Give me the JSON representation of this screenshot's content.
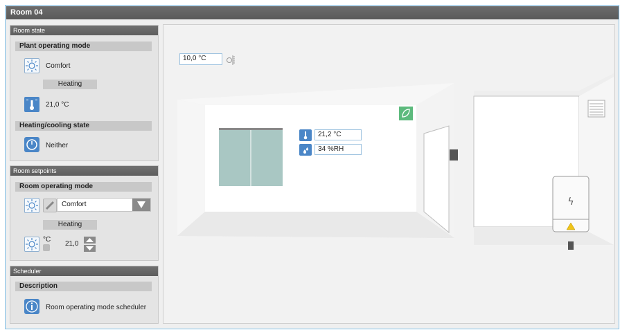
{
  "window": {
    "title": "Room 04"
  },
  "room_state": {
    "header": "Room state",
    "plant_mode": {
      "title": "Plant operating mode",
      "value": "Comfort",
      "status": "Heating",
      "temperature": "21,0 °C"
    },
    "hc_state": {
      "title": "Heating/cooling state",
      "value": "Neither"
    }
  },
  "room_setpoints": {
    "header": "Room setpoints",
    "operating_mode": {
      "title": "Room operating mode",
      "selected": "Comfort",
      "status": "Heating"
    },
    "setpoint": {
      "unit": "°C",
      "value": "21,0"
    }
  },
  "scheduler": {
    "header": "Scheduler",
    "description_title": "Description",
    "item": "Room operating mode scheduler"
  },
  "room_view": {
    "outside_temp": "10,0 °C",
    "room_temp": "21,2 °C",
    "room_humidity": "34 %RH"
  },
  "colors": {
    "accent_blue": "#4a86c7",
    "eco_green": "#5dba7d",
    "warning_yellow": "#f0c419"
  },
  "icons": [
    "sun-icon",
    "thermometer-icon",
    "power-icon",
    "edit-icon",
    "dropdown-arrow-icon",
    "spin-up-icon",
    "spin-down-icon",
    "info-icon",
    "leaf-icon",
    "droplets-icon",
    "outdoor-sensor-icon",
    "bolt-icon",
    "warning-icon",
    "vent-icon",
    "switch-icon"
  ]
}
